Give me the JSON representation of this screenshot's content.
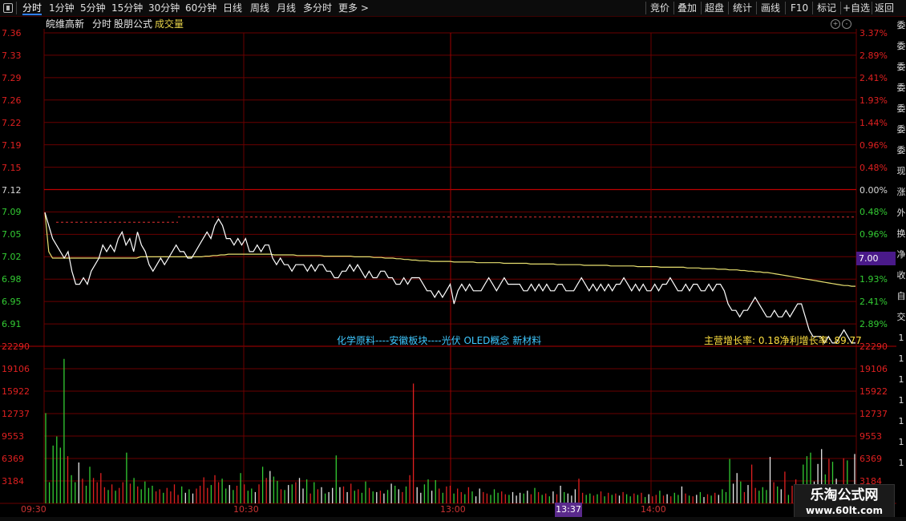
{
  "toolbar": {
    "left_tabs": [
      "分时",
      "1分钟",
      "5分钟",
      "15分钟",
      "30分钟",
      "60分钟",
      "日线",
      "周线",
      "月线",
      "多分时",
      "更多 >"
    ],
    "right_buttons": [
      "竞价",
      "叠加",
      "超盘",
      "统计",
      "画线",
      "F10",
      "标记",
      "+自选",
      "返回"
    ],
    "menu_icon": "window-menu-icon"
  },
  "header": {
    "stock_name": "皖维高新",
    "chart_mode": "分时",
    "formula": "股朋公式",
    "indicator": "成交量",
    "zoom_icon": "zoom-in-icon",
    "collapse_icon": "collapse-icon"
  },
  "info": {
    "concepts": "化学原料----安徽板块----光伏 OLED概念 新材料",
    "growth": "主营增长率: 0.18净利增长率: 89.77"
  },
  "crosshair": {
    "time": "13:37",
    "price": "7.00"
  },
  "right_strip_chars": [
    "委",
    "委",
    "委",
    "委",
    "委",
    "委",
    "委",
    "现",
    "涨",
    "外",
    "换",
    "净",
    "收",
    "自",
    "交",
    "1",
    "1",
    "1",
    "1",
    "1",
    "1",
    "1"
  ],
  "watermark": {
    "line1": "乐淘公式网",
    "line2": "www.60lt.com"
  },
  "colors": {
    "up": "#e02020",
    "down": "#33cc33",
    "price_line": "#ffffff",
    "avg_line": "#e8e070",
    "grid": "#6a0000",
    "flat": "#d8d8d8"
  },
  "chart_data": [
    {
      "type": "line",
      "title": "皖维高新 分时",
      "prev_close": 7.12,
      "y_left_ticks": [
        7.36,
        7.33,
        7.29,
        7.26,
        7.22,
        7.19,
        7.15,
        7.12,
        7.09,
        7.05,
        7.02,
        6.98,
        6.95,
        6.91
      ],
      "y_right_ticks": [
        "3.37%",
        "2.89%",
        "2.41%",
        "1.93%",
        "1.44%",
        "0.96%",
        "0.48%",
        "0.00%",
        "0.48%",
        "0.96%",
        "1.44%",
        "1.93%",
        "2.41%",
        "2.89%"
      ],
      "x_ticks": [
        "09:30",
        "10:30",
        "13:00",
        "14:00"
      ],
      "ylim": [
        6.895,
        7.375
      ],
      "series": [
        {
          "name": "price",
          "values": [
            7.1,
            7.08,
            7.06,
            7.05,
            7.04,
            7.03,
            7.04,
            7.01,
            6.99,
            6.99,
            7.0,
            6.99,
            7.01,
            7.02,
            7.03,
            7.05,
            7.04,
            7.05,
            7.04,
            7.06,
            7.07,
            7.05,
            7.06,
            7.04,
            7.07,
            7.05,
            7.04,
            7.02,
            7.01,
            7.02,
            7.03,
            7.02,
            7.03,
            7.04,
            7.05,
            7.04,
            7.04,
            7.03,
            7.03,
            7.04,
            7.05,
            7.06,
            7.07,
            7.06,
            7.08,
            7.09,
            7.08,
            7.06,
            7.06,
            7.05,
            7.06,
            7.05,
            7.06,
            7.04,
            7.04,
            7.05,
            7.04,
            7.05,
            7.05,
            7.03,
            7.02,
            7.03,
            7.02,
            7.02,
            7.01,
            7.02,
            7.02,
            7.02,
            7.01,
            7.02,
            7.01,
            7.02,
            7.02,
            7.01,
            7.01,
            7.0,
            7.0,
            7.01,
            7.01,
            7.02,
            7.01,
            7.02,
            7.01,
            7.0,
            7.01,
            7.0,
            7.0,
            7.01,
            7.01,
            7.0,
            7.0,
            6.99,
            6.99,
            7.0,
            6.99,
            7.0,
            7.0,
            7.0,
            6.99,
            6.98,
            6.98,
            6.97,
            6.98,
            6.97,
            6.98,
            6.99,
            6.96,
            6.98,
            6.99,
            6.98,
            6.99,
            6.98,
            6.98,
            6.98,
            6.99,
            7.0,
            6.99,
            6.98,
            6.99,
            7.0,
            6.99,
            6.99,
            6.99,
            6.99,
            6.98,
            6.98,
            6.99,
            6.98,
            6.99,
            6.98,
            6.99,
            6.98,
            6.98,
            6.99,
            6.99,
            6.98,
            6.98,
            6.98,
            6.99,
            7.0,
            6.99,
            6.98,
            6.99,
            6.98,
            6.99,
            6.98,
            6.99,
            6.98,
            6.99,
            6.99,
            7.0,
            6.99,
            6.98,
            6.99,
            6.98,
            6.99,
            6.98,
            6.98,
            6.99,
            6.98,
            6.99,
            6.99,
            7.0,
            6.99,
            6.98,
            6.98,
            6.99,
            6.98,
            6.99,
            6.99,
            6.98,
            6.98,
            6.99,
            6.98,
            6.99,
            6.99,
            6.98,
            6.96,
            6.95,
            6.95,
            6.94,
            6.95,
            6.95,
            6.96,
            6.97,
            6.96,
            6.95,
            6.94,
            6.94,
            6.95,
            6.94,
            6.94,
            6.95,
            6.94,
            6.95,
            6.96,
            6.96,
            6.94,
            6.92,
            6.91,
            6.91,
            6.91,
            6.9,
            6.91,
            6.9,
            6.9,
            6.91,
            6.92,
            6.91,
            6.9,
            6.9
          ]
        },
        {
          "name": "avg",
          "values": [
            7.1,
            7.04,
            7.03,
            7.03,
            7.03,
            7.03,
            7.03,
            7.03,
            7.03,
            7.03,
            7.03,
            7.03,
            7.03,
            7.03,
            7.03,
            7.03,
            7.03,
            7.03,
            7.03,
            7.03,
            7.03,
            7.03,
            7.03,
            7.03,
            7.03,
            7.032,
            7.032,
            7.032,
            7.032,
            7.032,
            7.032,
            7.032,
            7.032,
            7.032,
            7.032,
            7.032,
            7.032,
            7.032,
            7.032,
            7.032,
            7.032,
            7.032,
            7.033,
            7.033,
            7.034,
            7.034,
            7.035,
            7.035,
            7.036,
            7.036,
            7.036,
            7.036,
            7.036,
            7.036,
            7.036,
            7.036,
            7.036,
            7.036,
            7.036,
            7.036,
            7.035,
            7.035,
            7.035,
            7.035,
            7.035,
            7.035,
            7.034,
            7.034,
            7.034,
            7.034,
            7.034,
            7.034,
            7.034,
            7.033,
            7.033,
            7.033,
            7.033,
            7.033,
            7.033,
            7.033,
            7.033,
            7.032,
            7.032,
            7.032,
            7.032,
            7.032,
            7.031,
            7.031,
            7.031,
            7.03,
            7.03,
            7.03,
            7.029,
            7.029,
            7.028,
            7.028,
            7.027,
            7.027,
            7.026,
            7.026,
            7.026,
            7.025,
            7.025,
            7.025,
            7.025,
            7.025,
            7.025,
            7.024,
            7.024,
            7.024,
            7.024,
            7.024,
            7.024,
            7.023,
            7.023,
            7.023,
            7.023,
            7.023,
            7.023,
            7.023,
            7.022,
            7.022,
            7.022,
            7.022,
            7.022,
            7.022,
            7.022,
            7.021,
            7.021,
            7.021,
            7.021,
            7.021,
            7.021,
            7.021,
            7.02,
            7.02,
            7.02,
            7.02,
            7.02,
            7.02,
            7.02,
            7.019,
            7.019,
            7.019,
            7.019,
            7.019,
            7.019,
            7.019,
            7.018,
            7.018,
            7.018,
            7.018,
            7.018,
            7.018,
            7.018,
            7.017,
            7.017,
            7.017,
            7.017,
            7.017,
            7.017,
            7.016,
            7.016,
            7.016,
            7.016,
            7.016,
            7.016,
            7.016,
            7.015,
            7.015,
            7.015,
            7.015,
            7.014,
            7.014,
            7.014,
            7.014,
            7.013,
            7.013,
            7.013,
            7.012,
            7.012,
            7.012,
            7.011,
            7.011,
            7.01,
            7.01,
            7.009,
            7.009,
            7.008,
            7.008,
            7.007,
            7.006,
            7.005,
            7.004,
            7.003,
            7.002,
            7.001,
            7.0,
            6.999,
            6.998,
            6.997,
            6.996,
            6.995,
            6.994,
            6.993,
            6.992,
            6.991,
            6.99,
            6.989,
            6.988,
            6.988,
            6.987,
            6.987
          ]
        }
      ]
    },
    {
      "type": "bar",
      "title": "成交量",
      "y_ticks": [
        22290,
        19106,
        15922,
        12737,
        9553,
        6369,
        3184
      ],
      "ylim": [
        0,
        22290
      ],
      "note": "volume bars, colored by direction",
      "values": [
        12800,
        3000,
        8200,
        9500,
        7900,
        20500,
        6700,
        4000,
        3000,
        5800,
        3500,
        2500,
        5200,
        3600,
        3000,
        4300,
        2300,
        1900,
        2700,
        1800,
        2200,
        3000,
        7200,
        2800,
        3600,
        2400,
        2000,
        3100,
        2200,
        2500,
        1700,
        2000,
        1500,
        2200,
        1700,
        2700,
        1200,
        2400,
        1500,
        2000,
        1400,
        2100,
        2500,
        3700,
        2200,
        2600,
        4000,
        3000,
        3500,
        2100,
        2600,
        1900,
        2500,
        4300,
        2700,
        1800,
        2100,
        1600,
        2700,
        5200,
        3600,
        4600,
        3800,
        3200,
        2000,
        1900,
        2600,
        2700,
        3000,
        3600,
        2100,
        3400,
        1400,
        3000,
        2000,
        2300,
        1400,
        1600,
        2200,
        6800,
        2300,
        2400,
        1600,
        2800,
        1800,
        2000,
        1500,
        3100,
        2200,
        1700,
        1600,
        1800,
        1400,
        1900,
        2800,
        2500,
        2000,
        1600,
        2400,
        4000,
        17000,
        2300,
        1500,
        2700,
        3400,
        1800,
        3300,
        2100,
        1500,
        2400,
        2500,
        1400,
        2100,
        1600,
        1300,
        2300,
        1700,
        1000,
        2100,
        1600,
        1400,
        1200,
        2000,
        1500,
        1700,
        1300,
        1200,
        1600,
        1100,
        1500,
        1400,
        1800,
        1300,
        2200,
        1600,
        1200,
        1400,
        1000,
        1700,
        1300,
        2500,
        1600,
        1400,
        1100,
        2000,
        3500,
        1500,
        1200,
        1400,
        1100,
        1300,
        1700,
        1000,
        1500,
        1200,
        1400,
        1100,
        1600,
        1300,
        1000,
        1400,
        1200,
        1500,
        900,
        1300,
        1000,
        1200,
        1800,
        1100,
        1300,
        1000,
        1500,
        1200,
        2400,
        1400,
        1100,
        1000,
        1200,
        1600,
        900,
        1300,
        1100,
        1500,
        1200,
        2000,
        1600,
        6300,
        2800,
        4300,
        3100,
        1600,
        2600,
        5500,
        2200,
        1800,
        2300,
        1900,
        6600,
        3000,
        2400,
        2000,
        4500,
        1200,
        2500,
        3400,
        1700,
        5500,
        6700,
        7200,
        3100,
        5600,
        7700,
        4100,
        6300,
        5900,
        3500,
        2300,
        6400,
        6100,
        1700,
        7000
      ]
    }
  ]
}
